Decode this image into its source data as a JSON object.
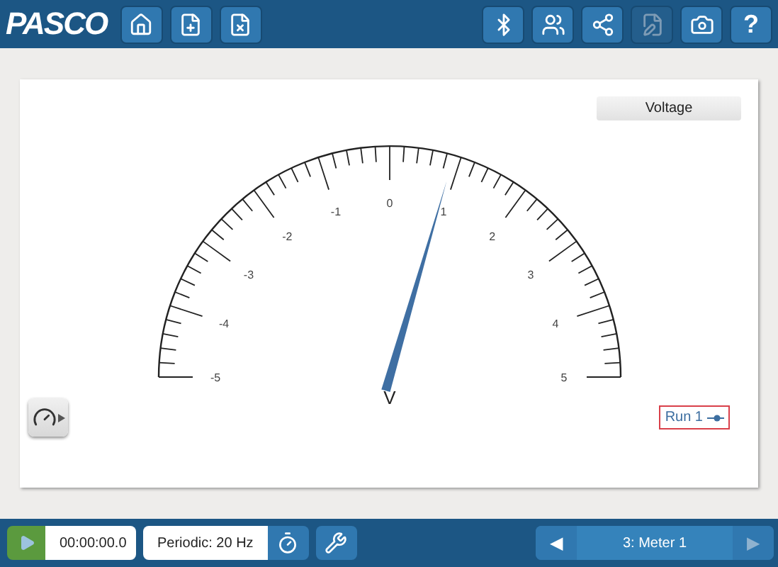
{
  "logo": "PASCO",
  "toolbar_left": [
    {
      "kind": "home",
      "disabled": false
    },
    {
      "kind": "new-file",
      "disabled": false
    },
    {
      "kind": "excel-file",
      "disabled": false
    }
  ],
  "toolbar_right": [
    {
      "kind": "bluetooth",
      "disabled": false
    },
    {
      "kind": "users",
      "disabled": false
    },
    {
      "kind": "share",
      "disabled": false
    },
    {
      "kind": "edit-file",
      "disabled": true
    },
    {
      "kind": "camera",
      "disabled": false
    },
    {
      "kind": "help",
      "label": "?",
      "disabled": false
    }
  ],
  "display": {
    "measurement": "Voltage",
    "meter": {
      "scale_labels": [
        "-5",
        "-4",
        "-3",
        "-2",
        "-1",
        "0",
        "1",
        "2",
        "3",
        "4",
        "5"
      ],
      "unit": "V",
      "level": 0.59
    },
    "legend": {
      "label": "Run 1"
    }
  },
  "controls": {
    "time": "00:00:00.0",
    "sampling": "Periodic: 20 Hz"
  },
  "page_nav": {
    "prev": {
      "label": "◀",
      "disabled": false
    },
    "page": "3: Meter 1",
    "next": {
      "label": "▶",
      "disabled": true
    }
  }
}
